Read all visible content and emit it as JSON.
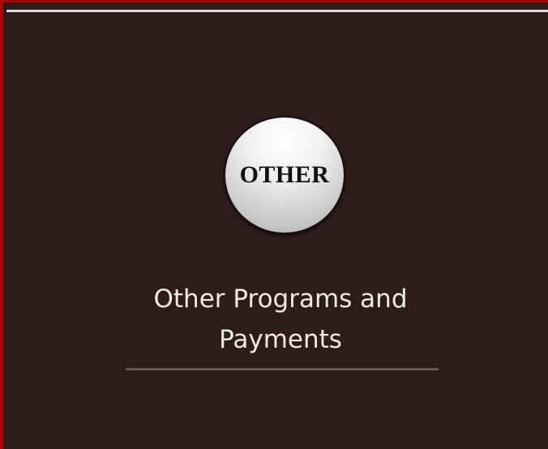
{
  "card": {
    "badge_text": "OTHER",
    "title_line1": "Other Programs and",
    "title_line2": "Payments"
  },
  "colors": {
    "background": "#2e1c1c",
    "border_accent": "#b00000",
    "title_text": "#efe9e9",
    "underline": "#6a5858"
  }
}
